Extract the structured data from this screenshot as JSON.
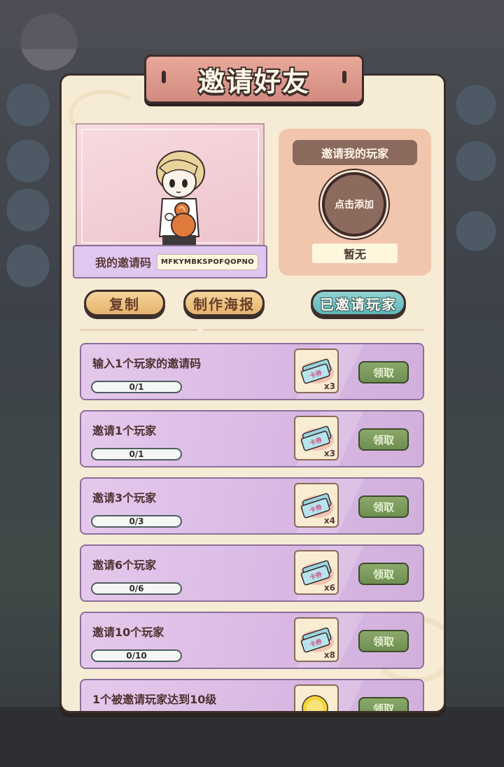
{
  "title": "邀请好友",
  "invite_code": {
    "label": "我的邀请码",
    "value": "MFKYMBKSPOFQOPNO"
  },
  "inviter": {
    "title": "邀请我的玩家",
    "add_button": "点击添加",
    "value": "暂无"
  },
  "buttons": {
    "copy": "复制",
    "make_poster": "制作海报",
    "invited_players": "已邀请玩家"
  },
  "tasks": [
    {
      "label": "输入1个玩家的邀请码",
      "progress": "0/1",
      "reward_icon": "card-ticket-icon",
      "reward_qty": "x3",
      "reward_text": "卡券",
      "claim": "领取"
    },
    {
      "label": "邀请1个玩家",
      "progress": "0/1",
      "reward_icon": "card-ticket-icon",
      "reward_qty": "x3",
      "reward_text": "卡券",
      "claim": "领取"
    },
    {
      "label": "邀请3个玩家",
      "progress": "0/3",
      "reward_icon": "card-ticket-icon",
      "reward_qty": "x4",
      "reward_text": "卡券",
      "claim": "领取"
    },
    {
      "label": "邀请6个玩家",
      "progress": "0/6",
      "reward_icon": "card-ticket-icon",
      "reward_qty": "x6",
      "reward_text": "卡券",
      "claim": "领取"
    },
    {
      "label": "邀请10个玩家",
      "progress": "0/10",
      "reward_icon": "card-ticket-icon",
      "reward_qty": "x8",
      "reward_text": "卡券",
      "claim": "领取"
    },
    {
      "label": "1个被邀请玩家达到10级",
      "progress": "",
      "reward_icon": "gold-coin-icon",
      "reward_qty": "",
      "reward_text": "",
      "claim": "领取"
    }
  ],
  "colors": {
    "panel": "#f6ecd6",
    "task_bg": "#d8b8e3",
    "claim_button": "#7a9a5e",
    "teal_button": "#6fc0c0",
    "title_banner": "#dd998d"
  }
}
